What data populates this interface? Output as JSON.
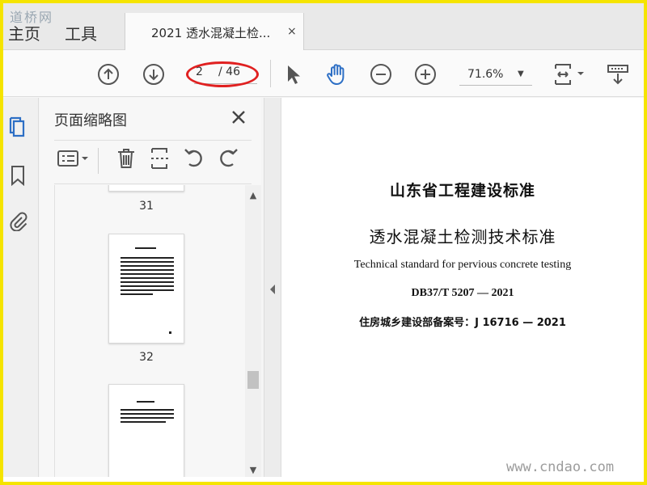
{
  "watermarks": {
    "top": "道桥网",
    "bottom": "www.cndao.com"
  },
  "tabs": {
    "home": "主页",
    "tools": "工具",
    "document_title": "2021 透水混凝土检...",
    "close_symbol": "×"
  },
  "toolbar": {
    "page_current": "2",
    "page_total": "/ 46",
    "zoom": "71.6%",
    "icons": [
      "arrow-up-circle-icon",
      "arrow-down-circle-icon",
      "pointer-icon",
      "hand-icon",
      "zoom-out-icon",
      "zoom-in-icon",
      "fit-page-icon",
      "scroll-mode-icon"
    ]
  },
  "panel": {
    "title": "页面缩略图",
    "close_symbol": "✕",
    "thumbnails": [
      {
        "label": "31"
      },
      {
        "label": "32"
      },
      {
        "label": ""
      }
    ]
  },
  "document": {
    "line1": "山东省工程建设标准",
    "line2": "透水混凝土检测技术标准",
    "line3": "Technical standard for pervious concrete testing",
    "line4": "DB37/T 5207 — 2021",
    "line5": "住房城乡建设部备案号：J 16716 — 2021"
  },
  "colors": {
    "frame": "#f5e400",
    "accent": "#2d6fc5",
    "annotation_oval": "#e02020"
  }
}
